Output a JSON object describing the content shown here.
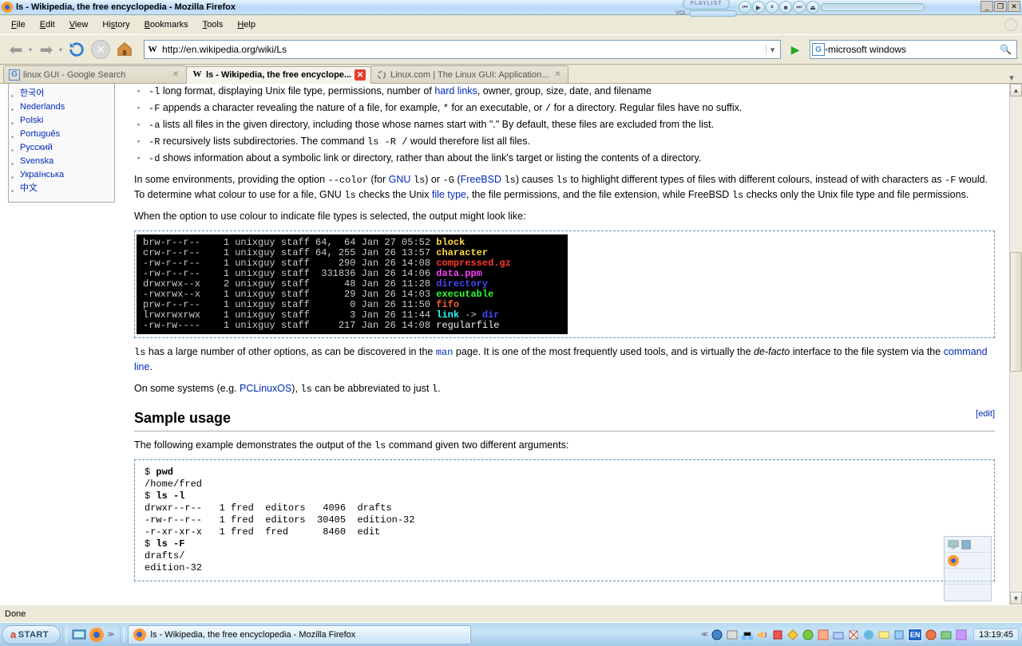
{
  "window": {
    "title": "ls - Wikipedia, the free encyclopedia - Mozilla Firefox"
  },
  "winamp": {
    "label_playlist": "PLAYLIST",
    "label_vol": "VOL"
  },
  "menubar": [
    "File",
    "Edit",
    "View",
    "History",
    "Bookmarks",
    "Tools",
    "Help"
  ],
  "url": "http://en.wikipedia.org/wiki/Ls",
  "searchbox": {
    "engine": "G",
    "query": "microsoft windows"
  },
  "tabs": [
    {
      "label": "linux GUI - Google Search",
      "icon": "G",
      "active": false
    },
    {
      "label": "ls - Wikipedia, the free encyclope...",
      "icon": "W",
      "active": true
    },
    {
      "label": "Linux.com | The Linux GUI: Application...",
      "icon": "spinner",
      "active": false
    }
  ],
  "languages": [
    "한국어",
    "Nederlands",
    "Polski",
    "Português",
    "Русский",
    "Svenska",
    "Українська",
    "中文"
  ],
  "article": {
    "opts": {
      "l": " long format, displaying Unix file type, permissions, number of ",
      "l_link": "hard links",
      "l_tail": ", owner, group, size, date, and filename",
      "F_pre": " appends a character revealing the nature of a file, for example, ",
      "F_star": "*",
      "F_mid": " for an executable, or ",
      "F_slash": "/",
      "F_tail": " for a directory. Regular files have no suffix.",
      "a": " lists all files in the given directory, including those whose names start with \".\" By default, these files are excluded from the list.",
      "R_pre": " recursively lists subdirectories. The command ",
      "R_cmd": "ls -R /",
      "R_tail": " would therefore list all files.",
      "d": " shows information about a symbolic link or directory, rather than about the link's target or listing the contents of a directory."
    },
    "env_para": {
      "p1": "In some environments, providing the option ",
      "color": "--color",
      "p2": " (for ",
      "gnu": "GNU",
      "p3": " ",
      "ls1": "ls",
      "p4": ") or ",
      "G": "-G",
      "p5": " (",
      "fbsd": "FreeBSD",
      "p6": " ",
      "ls2": "ls",
      "p7": ") causes ",
      "ls3": "ls",
      "p8": " to highlight different types of files with different colours, instead of with characters as ",
      "F2": "-F",
      "p9": " would. To determine what colour to use for a file, GNU ",
      "ls4": "ls",
      "p10": " checks the Unix ",
      "ftype": "file type",
      "p11": ", the file permissions, and the file extension, while FreeBSD ",
      "ls5": "ls",
      "p12": " checks only the Unix file type and file permissions."
    },
    "color_intro": "When the option to use colour to indicate file types is selected, the output might look like:",
    "term_lines": [
      {
        "meta": "brw-r--r--    1 unixguy staff 64,  64 Jan 27 05:52 ",
        "name": "block",
        "cls": "t-yellow"
      },
      {
        "meta": "crw-r--r--    1 unixguy staff 64, 255 Jan 26 13:57 ",
        "name": "character",
        "cls": "t-yellow"
      },
      {
        "meta": "-rw-r--r--    1 unixguy staff     290 Jan 26 14:08 ",
        "name": "compressed.gz",
        "cls": "t-red"
      },
      {
        "meta": "-rw-r--r--    1 unixguy staff  331836 Jan 26 14:06 ",
        "name": "data.ppm",
        "cls": "t-magenta"
      },
      {
        "meta": "drwxrwx--x    2 unixguy staff      48 Jan 26 11:28 ",
        "name": "directory",
        "cls": "t-blue"
      },
      {
        "meta": "-rwxrwx--x    1 unixguy staff      29 Jan 26 14:03 ",
        "name": "executable",
        "cls": "t-green"
      },
      {
        "meta": "prw-r--r--    1 unixguy staff       0 Jan 26 11:50 ",
        "name": "fifo",
        "cls": "t-orange"
      },
      {
        "meta": "lrwxrwxrwx    1 unixguy staff       3 Jan 26 11:44 ",
        "name": "link",
        "cls": "t-cyan",
        "extra": " -> ",
        "extra2": "dir",
        "extra2cls": "t-blue"
      },
      {
        "meta": "-rw-rw----    1 unixguy staff     217 Jan 26 14:08 ",
        "name": "regularfile",
        "cls": "t-white"
      }
    ],
    "man_para": {
      "p1": " has a large number of other options, as can be discovered in the ",
      "man": "man",
      "p2": " page. It is one of the most frequently used tools, and is virtually the ",
      "defacto": "de-facto",
      "p3": " interface to the file system via the ",
      "cmdline": "command line",
      "p4": "."
    },
    "pclinux": {
      "p1": "On some systems (e.g. ",
      "link": "PCLinuxOS",
      "p2": "), ",
      "ls": "ls",
      "p3": " can be abbreviated to just ",
      "l": "l",
      "p4": "."
    },
    "section_title": "Sample usage",
    "edit": "edit",
    "sample_intro": {
      "p1": "The following example demonstrates the output of the ",
      "ls": "ls",
      "p2": " command given two different arguments:"
    },
    "sample_pre": "$ pwd\n/home/fred\n$ ls -l\ndrwxr--r--   1 fred  editors   4096  drafts\n-rw-r--r--   1 fred  editors  30405  edition-32\n-r-xr-xr-x   1 fred  fred      8460  edit\n$ ls -F\ndrafts/\nedition-32"
  },
  "status": "Done",
  "taskbar": {
    "start": "START",
    "task": "ls - Wikipedia, the free encyclopedia - Mozilla Firefox",
    "clock": "13:19:45"
  }
}
